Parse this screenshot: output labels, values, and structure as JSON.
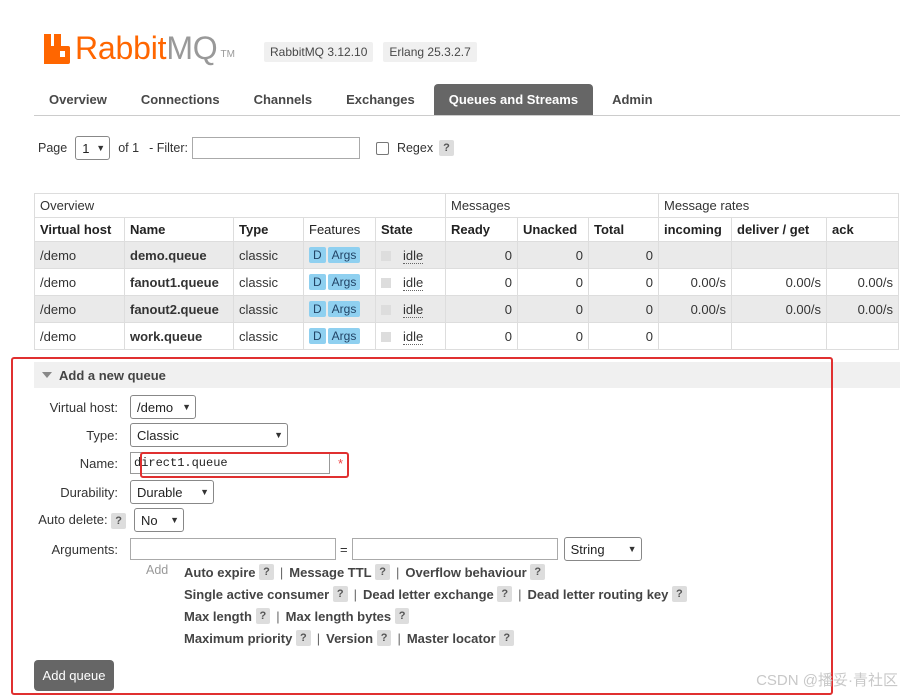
{
  "brand": {
    "rabbit": "Rabbit",
    "mq": "MQ",
    "tm": "TM",
    "logo_color": "#ff6600"
  },
  "versions": [
    "RabbitMQ 3.12.10",
    "Erlang 25.3.2.7"
  ],
  "tabs": [
    {
      "label": "Overview",
      "active": false
    },
    {
      "label": "Connections",
      "active": false
    },
    {
      "label": "Channels",
      "active": false
    },
    {
      "label": "Exchanges",
      "active": false
    },
    {
      "label": "Queues and Streams",
      "active": true
    },
    {
      "label": "Admin",
      "active": false
    }
  ],
  "pager": {
    "page_label": "Page",
    "page_value": "1",
    "of_label": "of 1",
    "filter_label": "- Filter:",
    "filter_value": "",
    "regex_label": "Regex",
    "help": "?"
  },
  "table": {
    "groups": [
      "Overview",
      "Messages",
      "Message rates"
    ],
    "columns": [
      "Virtual host",
      "Name",
      "Type",
      "Features",
      "State",
      "Ready",
      "Unacked",
      "Total",
      "incoming",
      "deliver / get",
      "ack"
    ],
    "rows": [
      {
        "vhost": "/demo",
        "name": "demo.queue",
        "type": "classic",
        "features": [
          "D",
          "Args"
        ],
        "state": "idle",
        "ready": "0",
        "unacked": "0",
        "total": "0",
        "incoming": "",
        "deliver": "",
        "ack": ""
      },
      {
        "vhost": "/demo",
        "name": "fanout1.queue",
        "type": "classic",
        "features": [
          "D",
          "Args"
        ],
        "state": "idle",
        "ready": "0",
        "unacked": "0",
        "total": "0",
        "incoming": "0.00/s",
        "deliver": "0.00/s",
        "ack": "0.00/s"
      },
      {
        "vhost": "/demo",
        "name": "fanout2.queue",
        "type": "classic",
        "features": [
          "D",
          "Args"
        ],
        "state": "idle",
        "ready": "0",
        "unacked": "0",
        "total": "0",
        "incoming": "0.00/s",
        "deliver": "0.00/s",
        "ack": "0.00/s"
      },
      {
        "vhost": "/demo",
        "name": "work.queue",
        "type": "classic",
        "features": [
          "D",
          "Args"
        ],
        "state": "idle",
        "ready": "0",
        "unacked": "0",
        "total": "0",
        "incoming": "",
        "deliver": "",
        "ack": ""
      }
    ]
  },
  "add_queue": {
    "title": "Add a new queue",
    "vhost_label": "Virtual host:",
    "vhost_value": "/demo",
    "type_label": "Type:",
    "type_value": "Classic",
    "name_label": "Name:",
    "name_value": "direct1.queue",
    "required_mark": "*",
    "durability_label": "Durability:",
    "durability_value": "Durable",
    "autodelete_label": "Auto delete:",
    "autodelete_help": "?",
    "autodelete_value": "No",
    "arguments_label": "Arguments:",
    "equals": "=",
    "arg_type_value": "String",
    "add_link": "Add",
    "option_rows": [
      [
        "Auto expire",
        "Message TTL",
        "Overflow behaviour"
      ],
      [
        "Single active consumer",
        "Dead letter exchange",
        "Dead letter routing key"
      ],
      [
        "Max length",
        "Max length bytes"
      ],
      [
        "Maximum priority",
        "Version",
        "Master locator"
      ]
    ],
    "submit": "Add queue"
  },
  "watermark": "CSDN @播妥·青社区",
  "highlight_color": "#e03030"
}
